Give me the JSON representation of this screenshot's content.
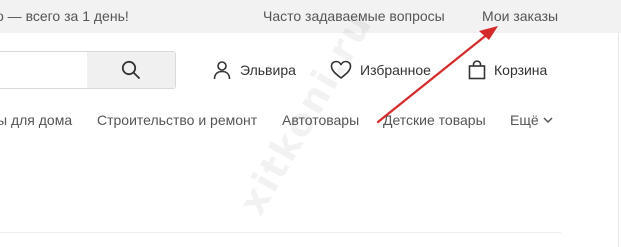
{
  "top_bar": {
    "promo_text": "о — всего за 1 день!",
    "faq_label": "Часто задаваемые вопросы",
    "orders_label": "Мои заказы"
  },
  "header": {
    "search_placeholder": "",
    "user_label": "Эльвира",
    "favorites_label": "Избранное",
    "cart_label": "Корзина"
  },
  "categories": {
    "items": [
      {
        "label": "ы для дома"
      },
      {
        "label": "Строительство и ремонт"
      },
      {
        "label": "Автотовары"
      },
      {
        "label": "Детские товары"
      }
    ],
    "more_label": "Ещё"
  },
  "watermark": {
    "text": "xitkoni.ru"
  },
  "colors": {
    "top_bar_bg": "#f2f2f2",
    "search_button_bg": "#f0f0f0",
    "arrow": "#d42a2a",
    "text": "#333333"
  },
  "icons": [
    "search-icon",
    "user-icon",
    "heart-icon",
    "bag-icon",
    "chevron-down-icon"
  ]
}
